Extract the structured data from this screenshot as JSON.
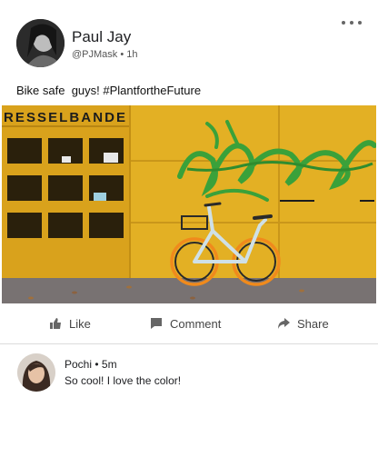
{
  "post": {
    "author_name": "Paul Jay",
    "author_handle": "@PJMask",
    "time": "1h",
    "text": "Bike safe  guys! #PlantfortheFuture",
    "image": {
      "sign_text": "RESSELBANDE"
    }
  },
  "actions": {
    "like": "Like",
    "comment": "Comment",
    "share": "Share"
  },
  "comment": {
    "author": "Pochi",
    "time": "5m",
    "text": "So cool! I love the color!"
  },
  "colors": {
    "wall_yellow": "#e6b31f",
    "graffiti_green": "#3aa13a",
    "bike_orange": "#f08a1c",
    "bike_frame": "#cfe0e6",
    "text_muted": "#555555"
  }
}
